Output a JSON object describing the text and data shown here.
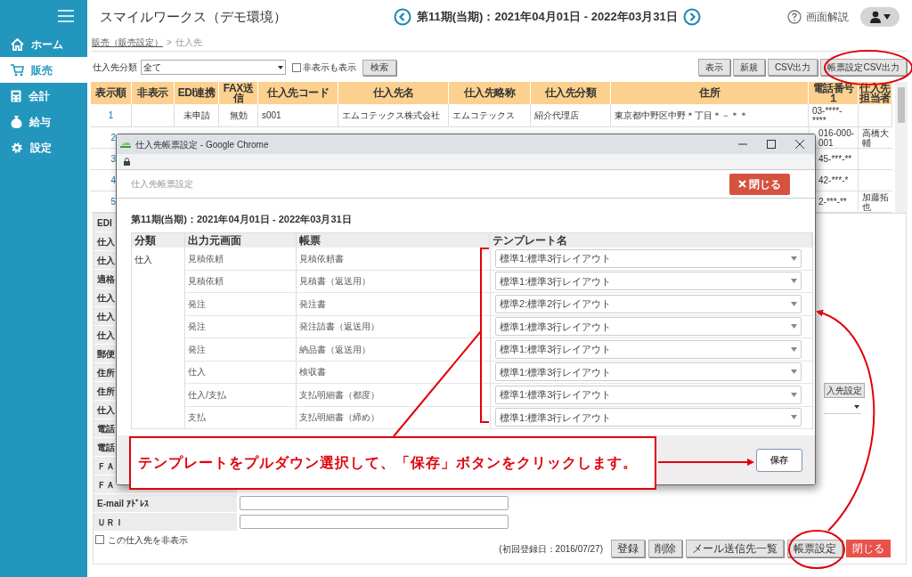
{
  "sidebar": {
    "items": [
      {
        "label": "ホーム",
        "selected": false
      },
      {
        "label": "販売",
        "selected": true
      },
      {
        "label": "会計",
        "selected": false
      },
      {
        "label": "給与",
        "selected": false
      },
      {
        "label": "設定",
        "selected": false
      }
    ]
  },
  "header": {
    "title": "スマイルワークス（デモ環境）",
    "period": "第11期(当期)：2021年04月01日 - 2022年03月31日",
    "help_label": "画面解説"
  },
  "breadcrumb": {
    "link": "販売（販売設定）",
    "separator": ">",
    "current": "仕入先"
  },
  "filter": {
    "label": "仕入先分類",
    "value": "全て",
    "show_hidden": {
      "label": "非表示も表示",
      "checked": false
    },
    "search_button": "検索"
  },
  "toolbar_buttons": [
    "表示",
    "新規",
    "CSV出力",
    "帳票設定CSV出力"
  ],
  "table": {
    "columns": [
      "表示順",
      "非表示",
      "EDI連携",
      "FAX送信",
      "仕入先コード",
      "仕入先名",
      "仕入先略称",
      "仕入先分類",
      "住所",
      "電話番号１",
      "仕入先担当者"
    ],
    "rows": [
      {
        "cells": [
          "1",
          "",
          "未申請",
          "無効",
          "s001",
          "エムコテックス株式会社",
          "エムコテックス",
          "紹介代理店",
          "東京都中野区中野＊丁目＊－＊＊",
          "03-****-****",
          ""
        ]
      }
    ],
    "partial_rows": [
      {
        "order": "2",
        "phone": "016-000-001",
        "staff": "高橋大輔"
      },
      {
        "order": "3",
        "phone": "45-***-**"
      },
      {
        "order": "4",
        "phone": "42-***-*"
      },
      {
        "order": "5",
        "phone": "2-***-**",
        "staff": "加藤拓也"
      }
    ]
  },
  "form": {
    "partial_labels": [
      "EDI",
      "仕入",
      "仕入",
      "適格",
      "仕入",
      "仕入",
      "仕入",
      "郵便",
      "住所",
      "住所",
      "仕入",
      "電話",
      "電話",
      "ＦＡ",
      "ＦＡ"
    ],
    "fields": [
      {
        "label": "E-mail ｱﾄﾞﾚｽ"
      },
      {
        "label": "ＵＲＩ"
      }
    ],
    "hide_checkbox": {
      "label": "この仕入先を非表示",
      "checked": false
    },
    "side_button": "入先設定",
    "registered": "(初回登録日：2016/07/27)",
    "buttons": [
      {
        "label": "登録",
        "kind": "default"
      },
      {
        "label": "削除",
        "kind": "default"
      },
      {
        "label": "メール送信先一覧",
        "kind": "default"
      },
      {
        "label": "帳票設定",
        "kind": "default"
      },
      {
        "label": "閉じる",
        "kind": "danger"
      }
    ]
  },
  "dialog": {
    "window_title": "仕入先帳票設定 - Google Chrome",
    "heading": "仕入先帳票設定",
    "close_button": "閉じる",
    "period": "第11期(当期)：2021年04月01日 - 2022年03月31日",
    "columns": [
      "分類",
      "出力元画面",
      "帳票",
      "テンプレート名"
    ],
    "category": "仕入",
    "rows": [
      {
        "source": "見積依頼",
        "form": "見積依頼書",
        "template": "標準1:標準3行レイアウト"
      },
      {
        "source": "見積依頼",
        "form": "見積書（返送用）",
        "template": "標準1:標準3行レイアウト"
      },
      {
        "source": "発注",
        "form": "発注書",
        "template": "標準2:標準2行レイアウト"
      },
      {
        "source": "発注",
        "form": "発注請書（返送用）",
        "template": "標準1:標準3行レイアウト"
      },
      {
        "source": "発注",
        "form": "納品書（返送用）",
        "template": "標準1:標準3行レイアウト"
      },
      {
        "source": "仕入",
        "form": "検収書",
        "template": "標準1:標準3行レイアウト"
      },
      {
        "source": "仕入/支払",
        "form": "支払明細書（都度）",
        "template": "標準1:標準3行レイアウト"
      },
      {
        "source": "支払",
        "form": "支払明細書（締め）",
        "template": "標準1:標準3行レイアウト"
      }
    ],
    "save_button": "保存"
  },
  "annotation": {
    "text": "テンプレートをプルダウン選択して、「保存」ボタンをクリックします。"
  }
}
